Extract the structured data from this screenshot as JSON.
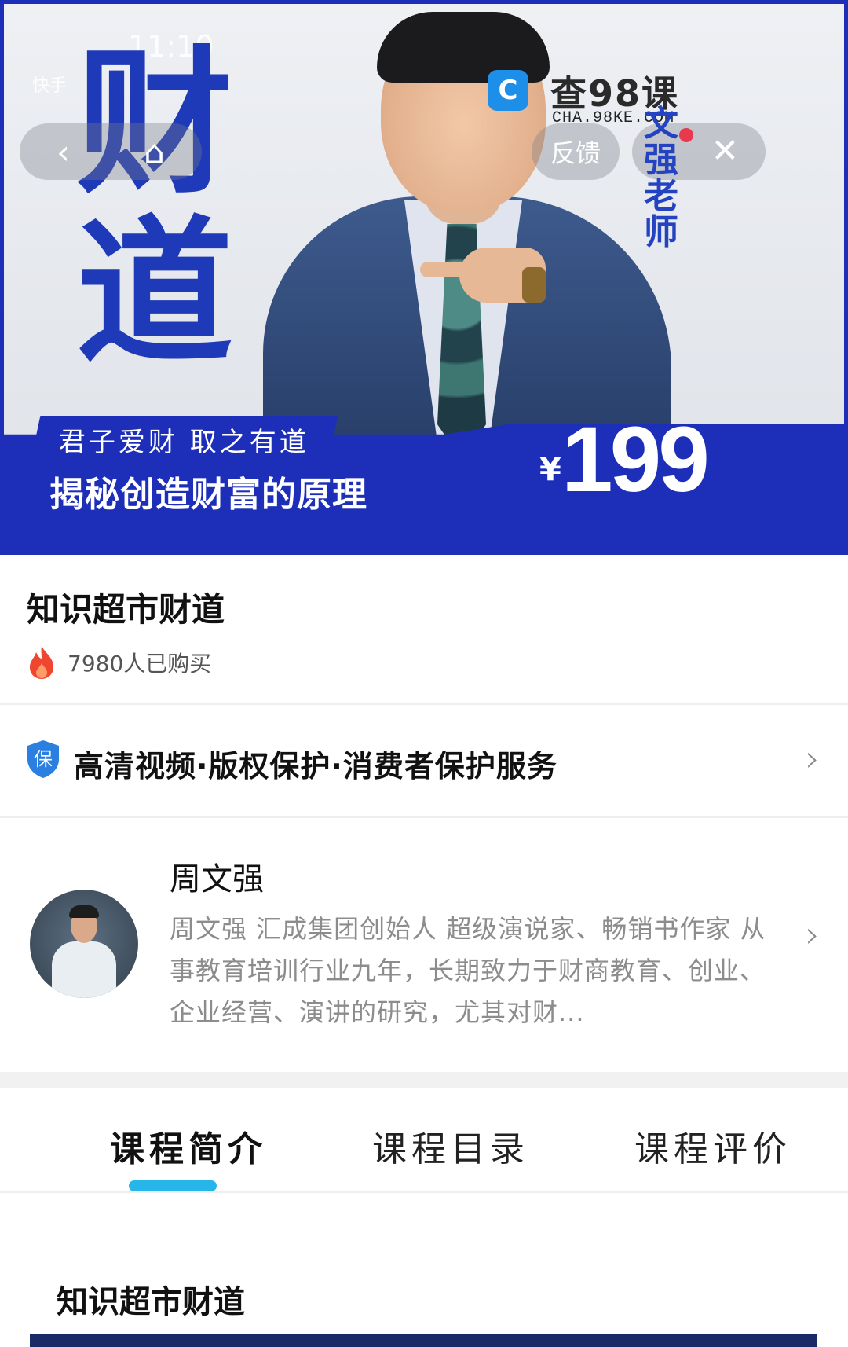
{
  "hero": {
    "status_time": "11:10",
    "app_name": "快手",
    "big_char_1": "财",
    "big_char_2": "道",
    "feedback_label": "反馈",
    "slogan": "君子爱财 取之有道",
    "headline": "揭秘创造财富的原理",
    "price_symbol": "¥",
    "price": "199",
    "teacher_name_chars": [
      "文",
      "强",
      "老",
      "师"
    ],
    "brand_color": "#1d2fb8"
  },
  "watermark": {
    "logo_glyph": "C",
    "name": "查98课",
    "domain": "CHA.98KE.COM"
  },
  "product": {
    "title": "知识超市财道",
    "buyers_text": "7980人已购买"
  },
  "service": {
    "badge": "保",
    "text": "高清视频·版权保护·消费者保护服务"
  },
  "teacher": {
    "name": "周文强",
    "bio": "周文强 汇成集团创始人 超级演说家、畅销书作家 从事教育培训行业九年，长期致力于财商教育、创业、企业经营、演讲的研究，尤其对财..."
  },
  "tabs": [
    {
      "label": "课程简介",
      "active": true
    },
    {
      "label": "课程目录",
      "active": false
    },
    {
      "label": "课程评价",
      "active": false
    }
  ],
  "intro": {
    "title": "知识超市财道"
  },
  "colors": {
    "accent": "#27b6ea",
    "muted_text": "#8c8c8c",
    "fire": "#f0452e"
  }
}
